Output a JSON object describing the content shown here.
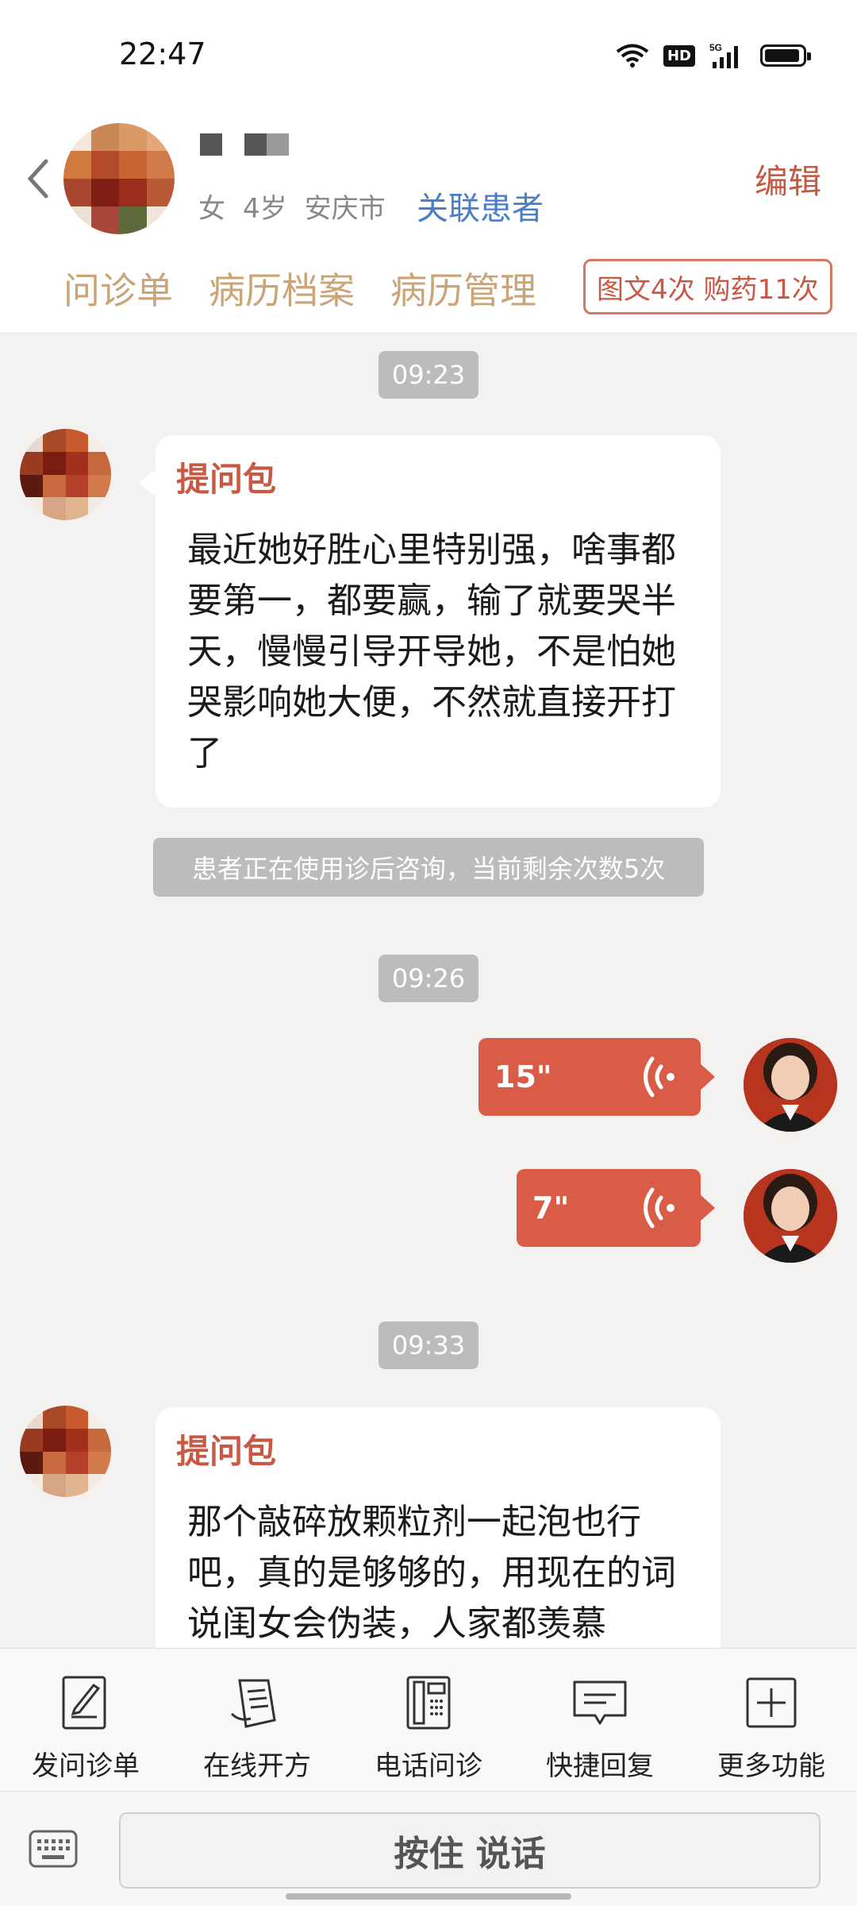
{
  "status_bar": {
    "time": "22:47",
    "hd": "HD",
    "network": "5G"
  },
  "header": {
    "patient_gender": "女",
    "patient_age": "4岁",
    "patient_city": "安庆市",
    "link_patient": "关联患者",
    "edit": "编辑",
    "tabs": [
      "问诊单",
      "病历档案",
      "病历管理"
    ],
    "stats": "图文4次 购药11次"
  },
  "chat": {
    "timestamps": [
      "09:23",
      "09:26",
      "09:33"
    ],
    "messages": [
      {
        "title": "提问包",
        "text": "最近她好胜心里特别强，啥事都要第一，都要赢，输了就要哭半天，慢慢引导开导她，不是怕她哭影响她大便，不然就直接开打了"
      },
      {
        "title": "提问包",
        "text": "那个敲碎放颗粒剂一起泡也行吧，真的是够够的，用现在的词说闺女会伪装，人家都羡慕"
      }
    ],
    "notice": "患者正在使用诊后咨询，当前剩余次数5次",
    "voice_messages": [
      {
        "duration": "15\""
      },
      {
        "duration": "7\""
      }
    ]
  },
  "toolbar": {
    "items": [
      {
        "label": "发问诊单",
        "icon": "form-pen-icon"
      },
      {
        "label": "在线开方",
        "icon": "prescription-icon"
      },
      {
        "label": "电话问诊",
        "icon": "phone-icon"
      },
      {
        "label": "快捷回复",
        "icon": "chat-reply-icon"
      },
      {
        "label": "更多功能",
        "icon": "plus-square-icon"
      }
    ]
  },
  "input_bar": {
    "hold_to_talk": "按住 说话"
  },
  "colors": {
    "accent": "#d95c47",
    "tab_text": "#c9a578",
    "link": "#4a7ec6",
    "pill": "#bcbcbc"
  }
}
